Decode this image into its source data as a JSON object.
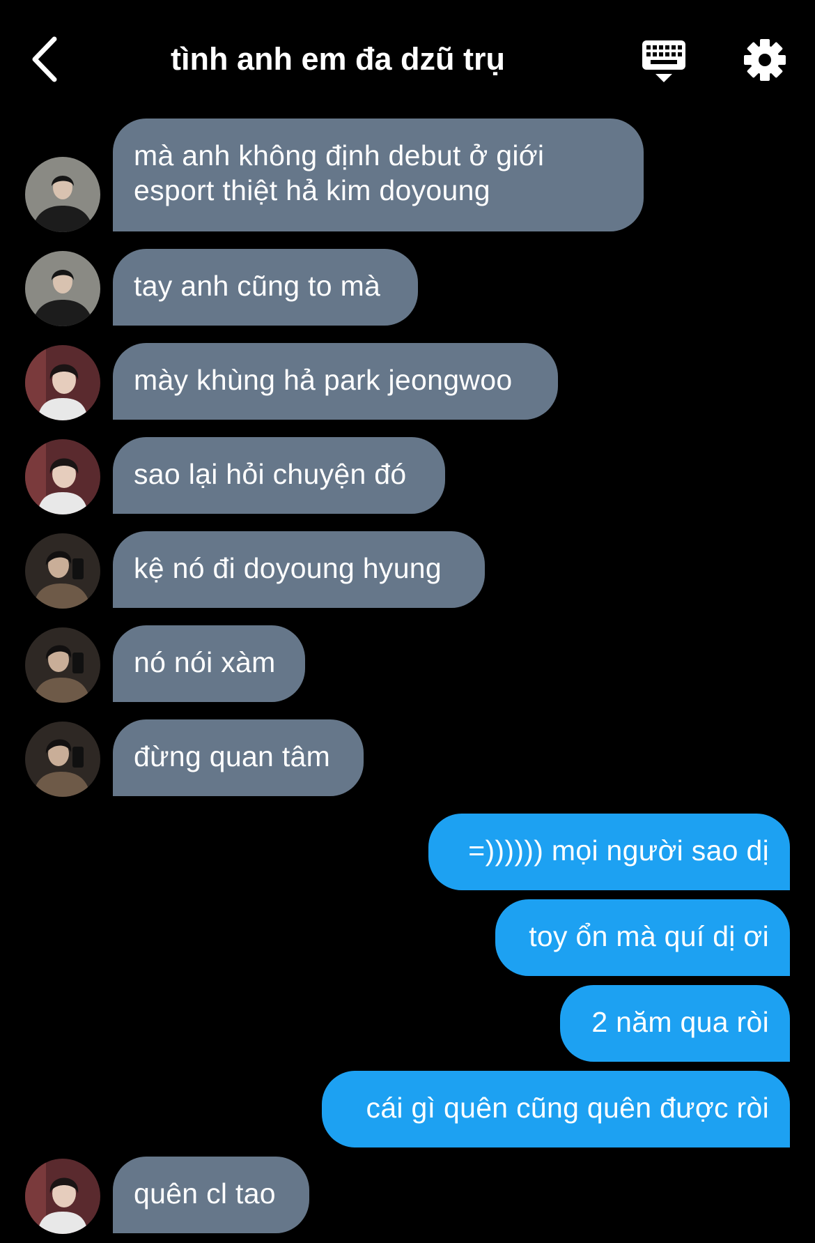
{
  "header": {
    "title": "tình anh em đa dzũ trụ",
    "back_icon": "chevron-left-icon",
    "keyboard_icon": "keyboard-icon",
    "settings_icon": "gear-icon"
  },
  "colors": {
    "background": "#000000",
    "incoming_bubble": "#66778a",
    "outgoing_bubble": "#1da1f2",
    "text": "#ffffff"
  },
  "messages": [
    {
      "sender": "avatar-a",
      "direction": "in",
      "text": "mà anh không định debut ở giới esport thiệt hả kim doyoung"
    },
    {
      "sender": "avatar-a",
      "direction": "in",
      "text": "tay anh cũng to mà"
    },
    {
      "sender": "avatar-b",
      "direction": "in",
      "text": "mày khùng hả park jeongwoo"
    },
    {
      "sender": "avatar-b",
      "direction": "in",
      "text": "sao lại hỏi chuyện đó"
    },
    {
      "sender": "avatar-c",
      "direction": "in",
      "text": "kệ nó đi doyoung hyung"
    },
    {
      "sender": "avatar-c",
      "direction": "in",
      "text": "nó nói xàm"
    },
    {
      "sender": "avatar-c",
      "direction": "in",
      "text": "đừng quan tâm"
    },
    {
      "sender": "me",
      "direction": "out",
      "text": "=)))))) mọi người sao dị"
    },
    {
      "sender": "me",
      "direction": "out",
      "text": "toy ổn mà quí dị ơi"
    },
    {
      "sender": "me",
      "direction": "out",
      "text": "2 năm qua ròi"
    },
    {
      "sender": "me",
      "direction": "out",
      "text": "cái gì quên cũng quên được ròi"
    },
    {
      "sender": "avatar-b",
      "direction": "in",
      "text": "quên cl tao"
    }
  ]
}
